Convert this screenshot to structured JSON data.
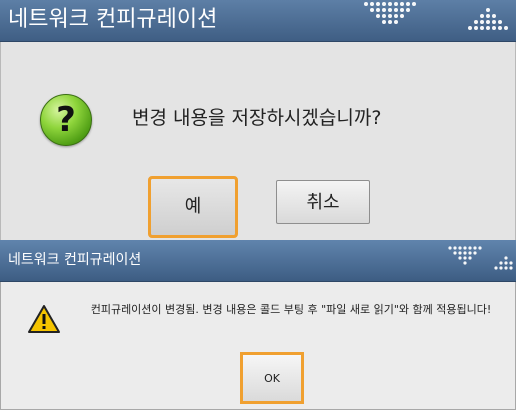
{
  "back_dialog": {
    "title": "네트워크 컨피규레이션",
    "icon": "question-icon",
    "message": "변경 내용을 저장하시겠습니까?",
    "yes_label": "예",
    "cancel_label": "취소",
    "question_glyph": "?"
  },
  "front_dialog": {
    "title": "네트워크 컨피규레이션",
    "icon": "warning-icon",
    "message": "컨피규레이션이 변경됨. 변경 내용은 콜드 부팅 후 \"파일 새로 읽기\"와 함께 적용됩니다!",
    "ok_label": "OK"
  },
  "colors": {
    "title_bar": "#4a6b93",
    "focus_outline": "#f0a030",
    "dialog_bg": "#e4e4e4",
    "warning_yellow": "#f5c400"
  }
}
